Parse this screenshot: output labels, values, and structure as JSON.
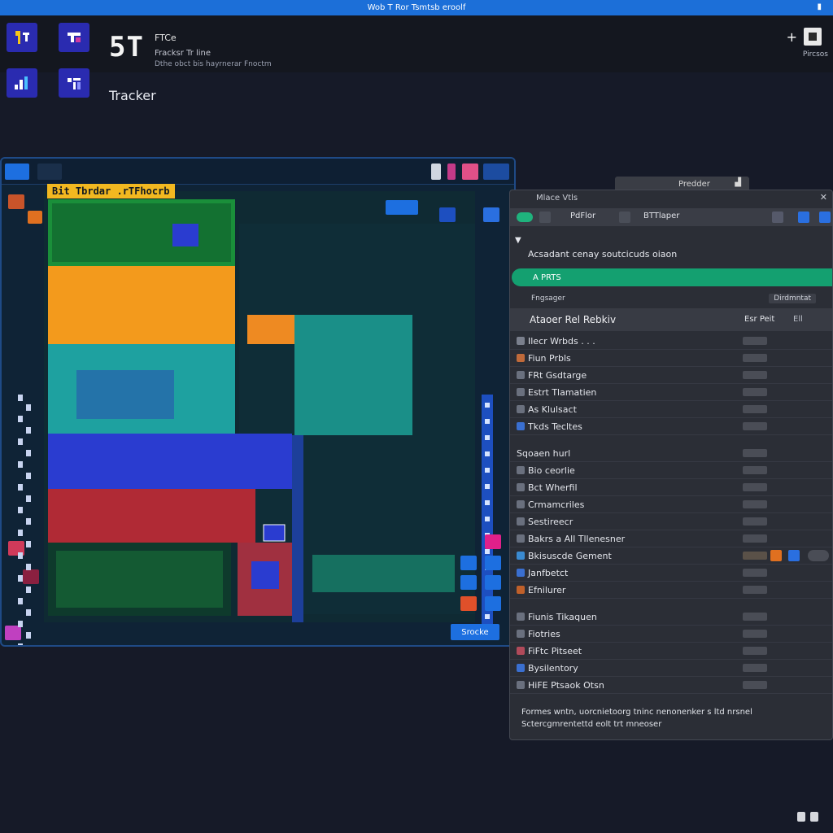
{
  "window": {
    "title": "Wob T Ror Tsmtsb eroolf",
    "close_glyph": "▮"
  },
  "header": {
    "logo_big": "5T",
    "logo_small": "FTCe",
    "subtitle_1": "Fracksr Tr line",
    "subtitle_2": "Dthe obct bis hayrnerar Fnoctm",
    "tracker_label": "Tracker",
    "plus_glyph": "+",
    "right_caption": "Pircsos"
  },
  "map": {
    "banner": "Bit Tbrdar .rTFhocrb",
    "action_button": "Srocke",
    "colors": {
      "orange": "#f39a1c",
      "teal": "#1ea1a0",
      "blue": "#2a3cd0",
      "red": "#b02a35",
      "green": "#1aa04a",
      "darkgreen": "#0e3a2c",
      "accent_orange": "#ee8a22"
    }
  },
  "panel": {
    "tab_label": "Predder",
    "header": "Mlace Vtls",
    "toolbar": {
      "item1": "PdFlor",
      "item2": "BTTlaper"
    },
    "sub_line": "▼",
    "description": "Acsadant cenay soutcicuds oiaon",
    "green_bar_label": "A PRTS",
    "row2_left": "Fngsager",
    "row2_right": "Dirdmntat",
    "list_header": {
      "col_a": "Ataoer Rel Rebkiv",
      "col_b": "Esr Peit",
      "col_c": "Ell"
    },
    "rows": [
      "Ilecr Wrbds . . .",
      "Fiun Prbls",
      "FRt Gsdtarge",
      "Estrt Tlamatien",
      "As Klulsact",
      "Tkds Tecltes",
      "",
      "Sqoaen hurl",
      "Bio ceorlie",
      "Bct Wherfil",
      "Crmamcriles",
      "Sestireecr",
      "Bakrs a All Tllenesner",
      "Bkisuscde Gement",
      "Janfbetct",
      "Efnilurer",
      "",
      "Fiunis Tikaquen",
      "Fiotries",
      "FiFtc Pitseet",
      "Bysilentory",
      "HiFE Ptsaok Otsn"
    ],
    "footer_1": "Formes wntn, uorcnietoorg tninc nenonenker s ltd nrsnel",
    "footer_2": "Sctercgmrentettd eolt trt mneoser"
  }
}
